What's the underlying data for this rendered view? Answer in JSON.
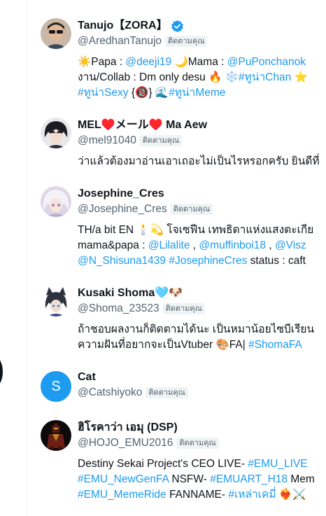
{
  "follows_you_label": "ติดตามคุณ",
  "accent_color": "#1d9bf0",
  "users": [
    {
      "name": "Tanujo【ZORA】",
      "handle": "@AredhanTanujo",
      "verified": true,
      "avatar": "avatar-photo-sunglasses",
      "bio": [
        {
          "t": "☀️Papa : "
        },
        {
          "t": "@deeji19",
          "link": true
        },
        {
          "t": " 🌙Mama : "
        },
        {
          "t": "@PuPonchanok",
          "link": true
        }
      ],
      "bio2": [
        {
          "t": "งาน/Collab : Dm only desu 🔥 ❄️"
        },
        {
          "t": "#ทูน่าChan",
          "link": true
        },
        {
          "t": " ⭐"
        }
      ],
      "bio3": [
        {
          "t": "#ทูน่าSexy",
          "link": true
        },
        {
          "t": " {🔞} 🌊"
        },
        {
          "t": "#ทูน่าMeme",
          "link": true
        }
      ]
    },
    {
      "name": "MEL♥️メール♥️ Ma Aew",
      "handle": "@mel91040",
      "avatar": "avatar-anime-dark-hair",
      "bio": [
        {
          "t": "ว่าแล้วต้องมาอ่านเอาเถอะไม่เป็นไรหรอกครับ ยินดีที่"
        }
      ]
    },
    {
      "name": "Josephine_Cres",
      "handle": "@Josephine_Cres",
      "avatar": "avatar-anime-white-hair",
      "bio": [
        {
          "t": "TH/a bit EN 🕯️💫 โจเซฟีน เทพธิดาแห่งแสงตะเกีย"
        }
      ],
      "bio2": [
        {
          "t": "mama&papa : "
        },
        {
          "t": "@Lilalite",
          "link": true
        },
        {
          "t": " , "
        },
        {
          "t": "@muffinboi18",
          "link": true
        },
        {
          "t": " , "
        },
        {
          "t": "@Visz",
          "link": true
        }
      ],
      "bio3": [
        {
          "t": "@N_Shisuna1439",
          "link": true
        },
        {
          "t": " "
        },
        {
          "t": "#JosephineCres",
          "link": true
        },
        {
          "t": " status : caft"
        }
      ]
    },
    {
      "name": "Kusaki Shoma🩵🐶",
      "handle": "@Shoma_23523",
      "avatar": "avatar-anime-dog-ears",
      "bio": [
        {
          "t": "ถ้าชอบผลงานก็ติดตามได้นะ เป็นหมาน้อยไซบีเรียน"
        }
      ],
      "bio2": [
        {
          "t": "ความฝันที่อยากจะเป็นVtuber 🎨FA| "
        },
        {
          "t": "#ShomaFA",
          "link": true
        }
      ]
    },
    {
      "name": "Cat",
      "handle": "@Catshiyoko",
      "avatar": "avatar-letter",
      "avatar_letter": "S",
      "bio": []
    },
    {
      "name": "ฮิโรคาว่า เอมุ (DSP)",
      "handle": "@HOJO_EMU2016",
      "avatar": "avatar-dark-armored-figure",
      "bio": [
        {
          "t": "Destiny Sekai Project's CEO LIVE- "
        },
        {
          "t": "#EMU_LIVE",
          "link": true
        }
      ],
      "bio2": [
        {
          "t": "#EMU_NewGenFA",
          "link": true
        },
        {
          "t": " NSFW- "
        },
        {
          "t": "#EMUART_H18",
          "link": true
        },
        {
          "t": " Mem"
        }
      ],
      "bio3": [
        {
          "t": "#EMU_MemeRide",
          "link": true
        },
        {
          "t": " FANNAME- "
        },
        {
          "t": "#เหล่าเคมี่",
          "link": true
        },
        {
          "t": " ❤️‍🔥⚔️"
        }
      ]
    }
  ]
}
